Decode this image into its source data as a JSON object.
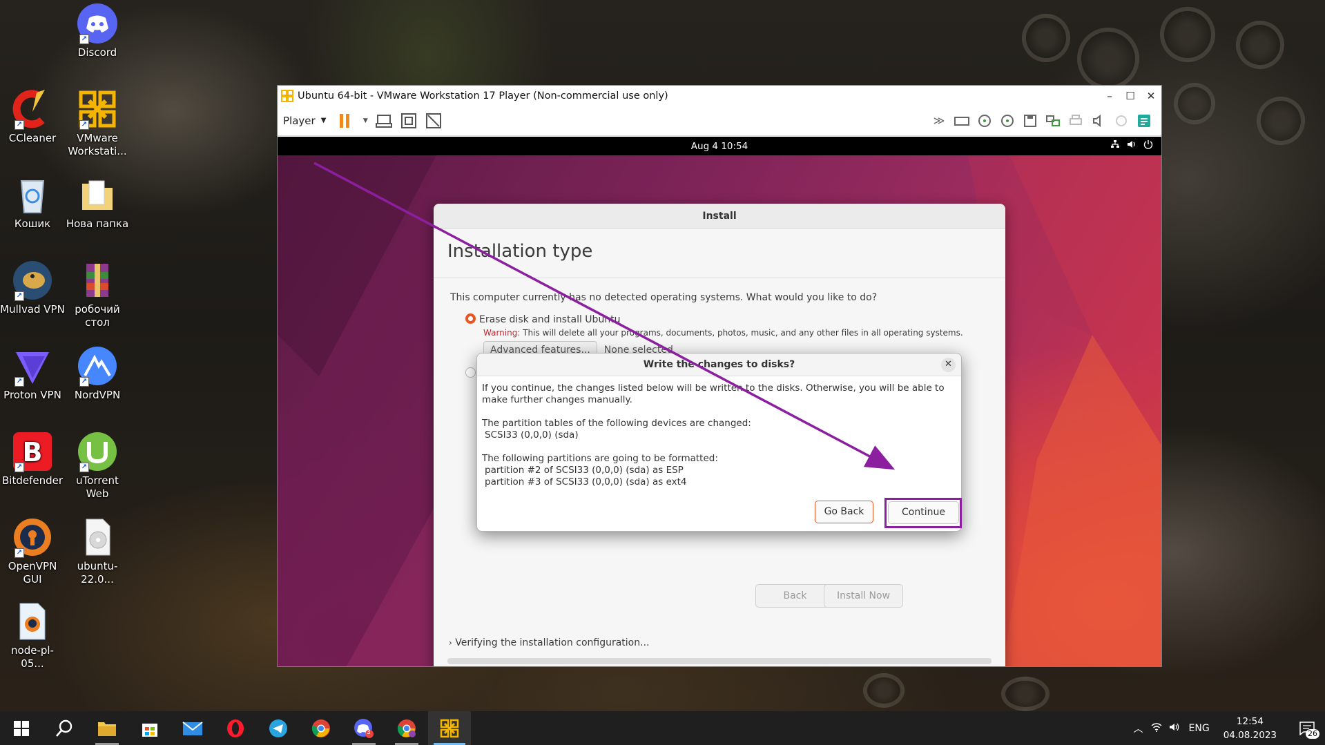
{
  "desktop": {
    "icons": [
      {
        "label": "Discord"
      },
      {
        "label": "CCleaner"
      },
      {
        "label": "VMware Workstati..."
      },
      {
        "label": "Кошик"
      },
      {
        "label": "Нова папка"
      },
      {
        "label": "Mullvad VPN"
      },
      {
        "label": "робочий стол"
      },
      {
        "label": "Proton VPN"
      },
      {
        "label": "NordVPN"
      },
      {
        "label": "Bitdefender"
      },
      {
        "label": "uTorrent Web"
      },
      {
        "label": "OpenVPN GUI"
      },
      {
        "label": "ubuntu-22.0..."
      },
      {
        "label": "node-pl-05..."
      }
    ]
  },
  "vmware": {
    "title": "Ubuntu 64-bit - VMware Workstation 17 Player (Non-commercial use only)",
    "player_menu": "Player",
    "accent": "#e95420"
  },
  "gnome": {
    "clock": "Aug 4  10:54"
  },
  "installer": {
    "window_title": "Install",
    "heading": "Installation type",
    "question": "This computer currently has no detected operating systems. What would you like to do?",
    "option_erase": "Erase disk and install Ubuntu",
    "warning_label": "Warning:",
    "warning_text": " This will delete all your programs, documents, photos, music, and any other files in all operating systems.",
    "advanced_button": "Advanced features...",
    "advanced_value": "None selected",
    "back_button": "Back",
    "install_button": "Install Now",
    "status": "Verifying the installation configuration..."
  },
  "dialog": {
    "title": "Write the changes to disks?",
    "para1": "If you continue, the changes listed below will be written to the disks. Otherwise, you will be able to make further changes manually.",
    "tables_heading": "The partition tables of the following devices are changed:",
    "tables_items": [
      "SCSI33 (0,0,0) (sda)"
    ],
    "partitions_heading": "The following partitions are going to be formatted:",
    "partitions_items": [
      "partition #2 of SCSI33 (0,0,0) (sda) as ESP",
      "partition #3 of SCSI33 (0,0,0) (sda) as ext4"
    ],
    "go_back": "Go Back",
    "continue": "Continue",
    "highlight_color": "#8b1fa0"
  },
  "taskbar": {
    "language": "ENG",
    "time": "12:54",
    "date": "04.08.2023",
    "notification_count": "26",
    "discord_badge": "3"
  }
}
